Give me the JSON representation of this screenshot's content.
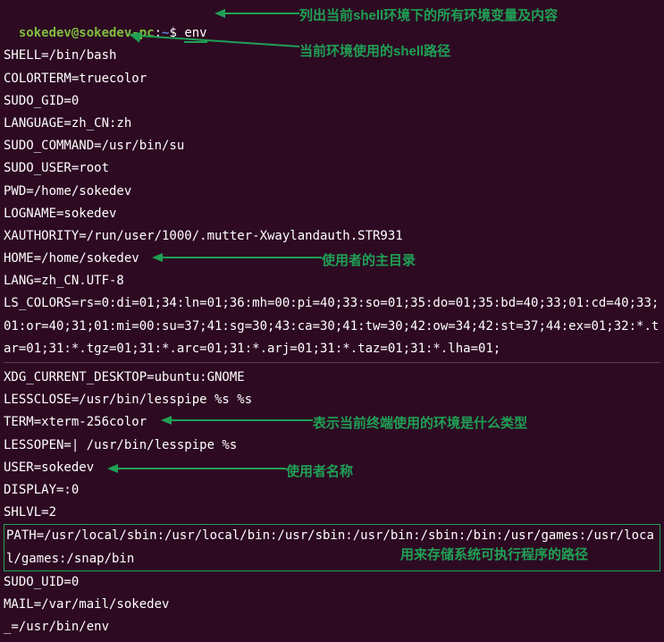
{
  "prompt": {
    "user_host": "sokedev@sokedev-pc",
    "separator": ":",
    "cwd": "~",
    "symbol": "$",
    "command": "env"
  },
  "env_lines": {
    "l1": "SHELL=/bin/bash",
    "l2": "COLORTERM=truecolor",
    "l3": "SUDO_GID=0",
    "l4": "LANGUAGE=zh_CN:zh",
    "l5": "SUDO_COMMAND=/usr/bin/su",
    "l6": "SUDO_USER=root",
    "l7": "PWD=/home/sokedev",
    "l8": "LOGNAME=sokedev",
    "l9": "XAUTHORITY=/run/user/1000/.mutter-Xwaylandauth.STR931",
    "l10": "HOME=/home/sokedev",
    "l11": "LANG=zh_CN.UTF-8",
    "l12": "LS_COLORS=rs=0:di=01;34:ln=01;36:mh=00:pi=40;33:so=01;35:do=01;35:bd=40;33;01:cd=40;33;01:or=40;31;01:mi=00:su=37;41:sg=30;43:ca=30;41:tw=30;42:ow=34;42:st=37;44:ex=01;32:*.tar=01;31:*.tgz=01;31:*.arc=01;31:*.arj=01;31:*.taz=01;31:*.lha=01;",
    "l13": "XDG_CURRENT_DESKTOP=ubuntu:GNOME",
    "l14": "LESSCLOSE=/usr/bin/lesspipe %s %s",
    "l15": "TERM=xterm-256color",
    "l16": "LESSOPEN=| /usr/bin/lesspipe %s",
    "l17": "USER=sokedev",
    "l18": "DISPLAY=:0",
    "l19": "SHLVL=2",
    "l20": "PATH=/usr/local/sbin:/usr/local/bin:/usr/sbin:/usr/bin:/sbin:/bin:/usr/games:/usr/local/games:/snap/bin",
    "l21": "SUDO_UID=0",
    "l22": "MAIL=/var/mail/sokedev",
    "l23": "_=/usr/bin/env"
  },
  "annotations": {
    "a1": "列出当前shell环境下的所有环境变量及内容",
    "a2": "当前环境使用的shell路径",
    "a3": "使用者的主目录",
    "a4": "表示当前终端使用的环境是什么类型",
    "a5": "使用者名称",
    "a6": "用来存储系统可执行程序的路径"
  }
}
